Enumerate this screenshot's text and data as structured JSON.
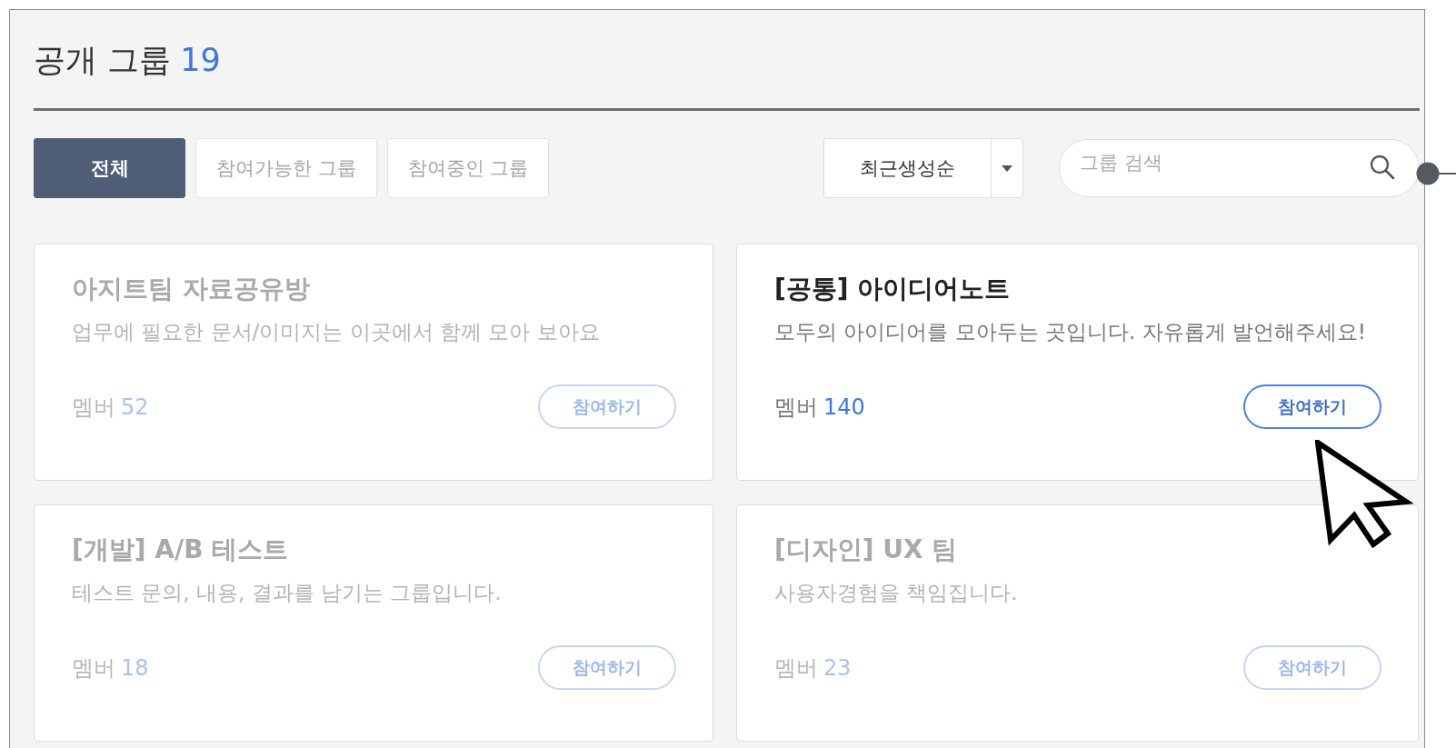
{
  "header": {
    "title": "공개 그룹",
    "count": "19"
  },
  "filters": [
    {
      "label": "전체",
      "selected": true
    },
    {
      "label": "참여가능한 그룹",
      "selected": false
    },
    {
      "label": "참여중인 그룹",
      "selected": false
    }
  ],
  "sort": {
    "value": "최근생성순"
  },
  "search": {
    "placeholder": "그룹 검색"
  },
  "groups": [
    {
      "name": "아지트팀 자료공유방",
      "description": "업무에 필요한 문서/이미지는 이곳에서 함께 모아 보아요",
      "member_label": "멤버",
      "member_count": "52",
      "button": "참여하기",
      "active": false
    },
    {
      "name": "[공통] 아이디어노트",
      "description": "모두의 아이디어를 모아두는 곳입니다. 자유롭게 발언해주세요!",
      "member_label": "멤버",
      "member_count": "140",
      "button": "참여하기",
      "active": true
    },
    {
      "name": "[개발] A/B 테스트",
      "description": "테스트 문의, 내용, 결과를 남기는 그룹입니다.",
      "member_label": "멤버",
      "member_count": "18",
      "button": "참여하기",
      "active": false
    },
    {
      "name": "[디자인] UX 팀",
      "description": "사용자경험을 책임집니다.",
      "member_label": "멤버",
      "member_count": "23",
      "button": "참여하기",
      "active": false
    }
  ]
}
